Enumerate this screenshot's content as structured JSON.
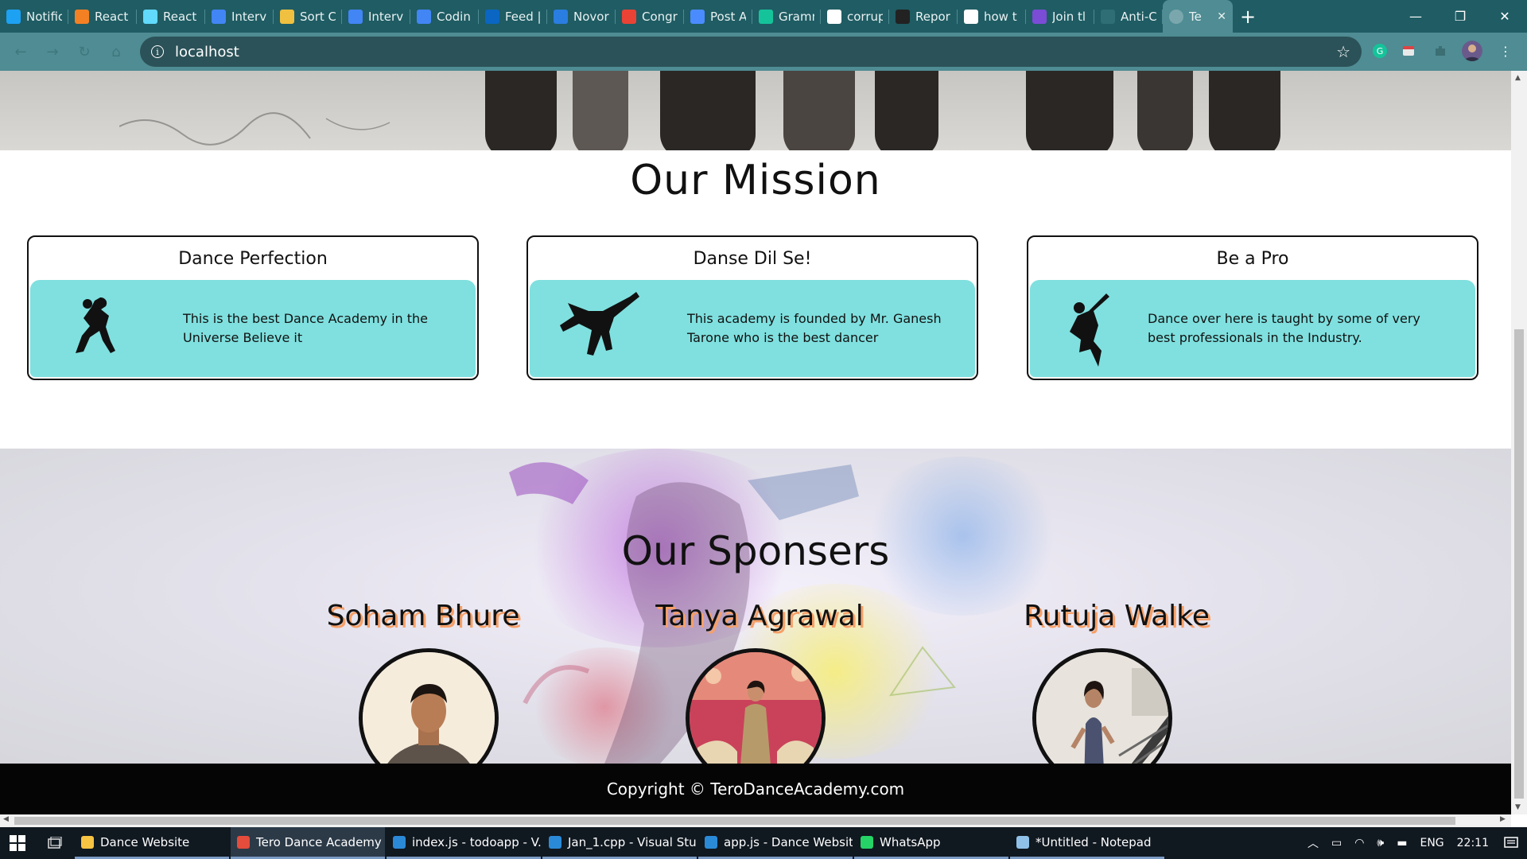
{
  "browser": {
    "tabs": [
      {
        "label": "Notific",
        "icon": "twitter-icon",
        "color": "#1da1f2"
      },
      {
        "label": "React",
        "icon": "stackoverflow-icon",
        "color": "#f48024"
      },
      {
        "label": "React",
        "icon": "react-icon",
        "color": "#61dafb"
      },
      {
        "label": "Intervi",
        "icon": "docs-icon",
        "color": "#4285f4"
      },
      {
        "label": "Sort C",
        "icon": "code-icon",
        "color": "#f0c040"
      },
      {
        "label": "Intervi",
        "icon": "docs-icon",
        "color": "#4285f4"
      },
      {
        "label": "Codin",
        "icon": "docs-icon",
        "color": "#4285f4"
      },
      {
        "label": "Feed |",
        "icon": "linkedin-icon",
        "color": "#0a66c2"
      },
      {
        "label": "Novor",
        "icon": "n-icon",
        "color": "#2a7de1"
      },
      {
        "label": "Congr",
        "icon": "gmail-icon",
        "color": "#ea4335"
      },
      {
        "label": "Post A",
        "icon": "meet-icon",
        "color": "#4a8cff"
      },
      {
        "label": "Gramm",
        "icon": "grammarly-icon",
        "color": "#15c39a"
      },
      {
        "label": "corrup",
        "icon": "google-icon",
        "color": "#ffffff"
      },
      {
        "label": "Repor",
        "icon": "github-icon",
        "color": "#222222"
      },
      {
        "label": "how t",
        "icon": "google-icon",
        "color": "#ffffff"
      },
      {
        "label": "Join tl",
        "icon": "list-icon",
        "color": "#7b4cd6"
      },
      {
        "label": "Anti-C",
        "icon": "page-icon",
        "color": "#2e6e74"
      }
    ],
    "active_tab": {
      "label": "Te",
      "icon": "globe-icon"
    },
    "new_tab": "+",
    "url": "localhost"
  },
  "page": {
    "mission_title": "Our Mission",
    "cards": [
      {
        "title": "Dance Perfection",
        "text": "This is the best Dance Academy in the Universe Believe it"
      },
      {
        "title": "Danse Dil Se!",
        "text": "This academy is founded by Mr. Ganesh Tarone who is the best dancer"
      },
      {
        "title": "Be a Pro",
        "text": "Dance over here is taught by some of very best professionals in the Industry."
      }
    ],
    "sponsors_title": "Our Sponsers",
    "sponsors": [
      {
        "name": "Soham Bhure"
      },
      {
        "name": "Tanya Agrawal"
      },
      {
        "name": "Rutuja Walke"
      }
    ],
    "footer": "Copyright © TeroDanceAcademy.com"
  },
  "taskbar": {
    "items": [
      {
        "label": "Dance Website",
        "icon": "folder-icon",
        "color": "#f6c343"
      },
      {
        "label": "Tero Dance Academy ...",
        "icon": "chrome-icon",
        "color": "#e44c3c"
      },
      {
        "label": "index.js - todoapp - V...",
        "icon": "vscode-icon",
        "color": "#2b8ad8"
      },
      {
        "label": "Jan_1.cpp - Visual Stu...",
        "icon": "vscode-icon",
        "color": "#2b8ad8"
      },
      {
        "label": "app.js - Dance Websit...",
        "icon": "vscode-icon",
        "color": "#2b8ad8"
      },
      {
        "label": "WhatsApp",
        "icon": "whatsapp-icon",
        "color": "#25d366"
      },
      {
        "label": "*Untitled - Notepad",
        "icon": "notepad-icon",
        "color": "#8fc1e8"
      }
    ],
    "language": "ENG",
    "time": "22:11"
  }
}
